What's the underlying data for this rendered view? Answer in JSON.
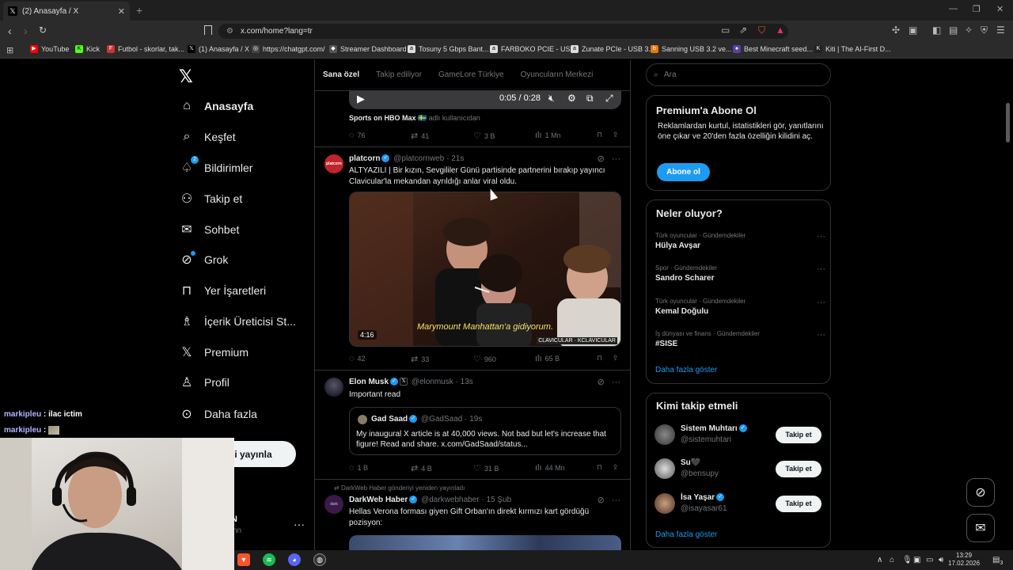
{
  "browser": {
    "tab_title": "(2) Anasayfa / X",
    "url": "x.com/home?lang=tr",
    "bookmarks": [
      "YouTube",
      "Kick",
      "Futbol - skorlar, tak...",
      "(1) Anasayfa / X",
      "https://chatgpt.com/",
      "Streamer Dashboard",
      "Tosuny 5 Gbps Bant...",
      "FARBOKO PCIE - US...",
      "Zunate PCIe - USB 3...",
      "Sanning USB 3.2 ve...",
      "Best Minecraft seed...",
      "Kiti | The AI-First D..."
    ]
  },
  "nav": {
    "items": [
      {
        "label": "Anasayfa",
        "icon": "home-icon"
      },
      {
        "label": "Keşfet",
        "icon": "search-icon"
      },
      {
        "label": "Bildirimler",
        "icon": "bell-icon",
        "badge": "2"
      },
      {
        "label": "Takip et",
        "icon": "person-add-icon"
      },
      {
        "label": "Sohbet",
        "icon": "mail-icon"
      },
      {
        "label": "Grok",
        "icon": "grok-icon"
      },
      {
        "label": "Yer İşaretleri",
        "icon": "bookmark-icon"
      },
      {
        "label": "İçerik Üreticisi St...",
        "icon": "creator-studio-icon"
      },
      {
        "label": "Premium",
        "icon": "x-icon"
      },
      {
        "label": "Profil",
        "icon": "person-icon"
      },
      {
        "label": "Daha fazla",
        "icon": "more-circle-icon"
      }
    ],
    "post_button": "i yayınla",
    "account_initial": "N",
    "account_handle": "nn"
  },
  "timeline": {
    "tabs": [
      "Sana özel",
      "Takip ediliyor",
      "GameLore Türkiye",
      "Oyuncuların Merkezi"
    ],
    "top_video": {
      "time": "0:05 / 0:28",
      "attribution_name": "Sports on HBO Max",
      "attribution_sub": "adlı kullanıcıdan",
      "stats": {
        "replies": "76",
        "reposts": "41",
        "likes": "3 B",
        "views": "1 Mn"
      }
    },
    "post1": {
      "name": "platcorn",
      "handle": "@platcornweb",
      "time": "21s",
      "text": "ALTYAZILI | Bir kızın, Sevgililer Günü partisinde partnerini bırakıp yayıncı Clavicular'la mekandan ayrıldığı anlar viral oldu.",
      "media_duration": "4:16",
      "media_caption": "Marymount Manhattan'a gidiyorum.",
      "media_watermark": "CLAVICULAR · KCLAVICULAR",
      "stats": {
        "replies": "42",
        "reposts": "33",
        "likes": "960",
        "views": "65 B"
      }
    },
    "post2": {
      "name": "Elon Musk",
      "handle": "@elonmusk",
      "time": "13s",
      "text": "Important read",
      "quote": {
        "name": "Gad Saad",
        "handle": "@GadSaad",
        "time": "19s",
        "text": "My inaugural X article is at 40,000 views.  Not bad but let's increase that figure!  Read and share. x.com/GadSaad/status..."
      },
      "stats": {
        "replies": "1 B",
        "reposts": "4 B",
        "likes": "31 B",
        "views": "44 Mn"
      }
    },
    "post3": {
      "repost_label": "DarkWeb Haber gönderiyi yeniden yayınladı",
      "name": "DarkWeb Haber",
      "handle": "@darkwebhaber",
      "time": "15 Şub",
      "text": "Hellas Verona forması giyen Gift Orban'ın direkt kırmızı kart gördüğü pozisyon:"
    }
  },
  "sidebar": {
    "search_placeholder": "Ara",
    "premium": {
      "title": "Premium'a Abone Ol",
      "text": "Reklamlardan kurtul, istatistikleri gör, yanıtlarını öne çıkar ve 20'den fazla özelliğin kilidini aç.",
      "button": "Abone ol"
    },
    "trends": {
      "title": "Neler oluyor?",
      "items": [
        {
          "category": "Türk oyuncular · Gündemdekiler",
          "topic": "Hülya Avşar"
        },
        {
          "category": "Spor · Gündemdekiler",
          "topic": "Sandro Scharer"
        },
        {
          "category": "Türk oyuncular · Gündemdekiler",
          "topic": "Kemal Doğulu"
        },
        {
          "category": "İş dünyası ve finans · Gündemdekiler",
          "topic": "#SISE"
        }
      ],
      "show_more": "Daha fazla göster"
    },
    "who_to_follow": {
      "title": "Kimi takip etmeli",
      "items": [
        {
          "name": "Sistem Muhtarı",
          "handle": "@sistemuhtari",
          "button": "Takip et"
        },
        {
          "name": "Su🖤",
          "handle": "@bensupy",
          "button": "Takip et"
        },
        {
          "name": "İsa Yaşar",
          "handle": "@isayasar61",
          "button": "Takip et"
        }
      ],
      "show_more": "Daha fazla göster"
    }
  },
  "overlay": {
    "chat": [
      {
        "user": "markipleu",
        "message": "ilac ictim"
      },
      {
        "user": "markipleu",
        "message": ""
      }
    ]
  },
  "taskbar": {
    "time": "13:29",
    "date": "17.02.2026",
    "notifications": "3"
  }
}
